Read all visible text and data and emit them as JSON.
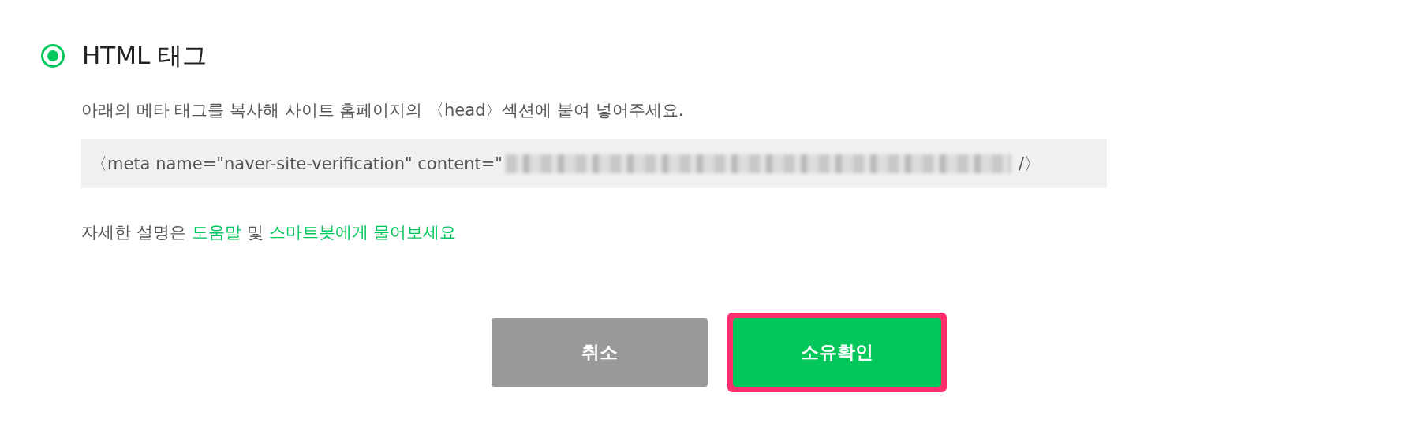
{
  "option": {
    "label": "HTML 태그",
    "selected": true
  },
  "instruction": "아래의 메타 태그를 복사해 사이트 홈페이지의 〈head〉섹션에 붙여 넣어주세요.",
  "code": {
    "prefix": "〈meta name=\"naver-site-verification\" content=\"",
    "suffix": "/〉"
  },
  "help": {
    "text": "자세한 설명은",
    "link1": "도움말",
    "conjunction": "및",
    "link2": "스마트봇에게 물어보세요"
  },
  "buttons": [
    {
      "kind": "cancel",
      "label": "취소",
      "highlighted": false
    },
    {
      "kind": "confirm",
      "label": "소유확인",
      "highlighted": true
    }
  ]
}
